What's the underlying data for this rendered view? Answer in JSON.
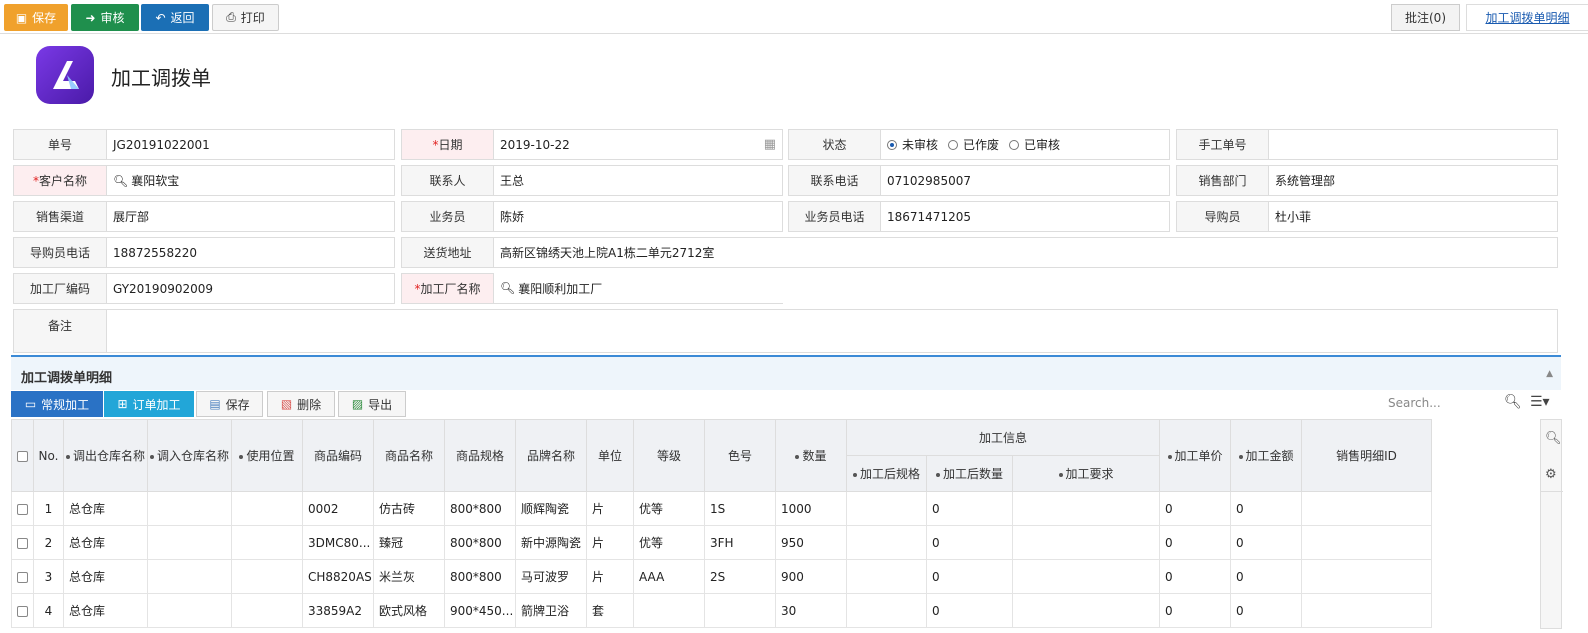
{
  "toolbar": {
    "save": "保存",
    "audit": "审核",
    "back": "返回",
    "print": "打印",
    "note": "批注(0)",
    "detail_link": "加工调拨单明细"
  },
  "page": {
    "title": "加工调拨单"
  },
  "form": {
    "order_no": {
      "label": "单号",
      "value": "JG20191022001"
    },
    "date": {
      "label": "日期",
      "value": "2019-10-22"
    },
    "status": {
      "label": "状态",
      "options": [
        "未审核",
        "已作废",
        "已审核"
      ],
      "selected": "未审核"
    },
    "manual_no": {
      "label": "手工单号",
      "value": ""
    },
    "customer": {
      "label": "客户名称",
      "value": "襄阳软宝"
    },
    "contact": {
      "label": "联系人",
      "value": "王总"
    },
    "phone": {
      "label": "联系电话",
      "value": "07102985007"
    },
    "sales_dept": {
      "label": "销售部门",
      "value": "系统管理部"
    },
    "channel": {
      "label": "销售渠道",
      "value": "展厅部"
    },
    "salesman": {
      "label": "业务员",
      "value": "陈娇"
    },
    "salesman_phone": {
      "label": "业务员电话",
      "value": "18671471205"
    },
    "guide": {
      "label": "导购员",
      "value": "杜小菲"
    },
    "guide_phone": {
      "label": "导购员电话",
      "value": "18872558220"
    },
    "address": {
      "label": "送货地址",
      "value": "高新区锦绣天池上院A1栋二单元2712室"
    },
    "factory_code": {
      "label": "加工厂编码",
      "value": "GY20190902009"
    },
    "factory_name": {
      "label": "加工厂名称",
      "value": "襄阳顺利加工厂"
    },
    "remark": {
      "label": "备注",
      "value": ""
    }
  },
  "detail": {
    "title": "加工调拨单明细",
    "buttons": {
      "regular": "常规加工",
      "order": "订单加工",
      "save": "保存",
      "delete": "删除",
      "export": "导出"
    },
    "search_placeholder": "Search...",
    "columns": {
      "no": "No.",
      "out_wh": "调出仓库名称",
      "in_wh": "调入仓库名称",
      "location": "使用位置",
      "code": "商品编码",
      "name": "商品名称",
      "spec": "商品规格",
      "brand": "品牌名称",
      "unit": "单位",
      "grade": "等级",
      "color": "色号",
      "qty": "数量",
      "proc_group": "加工信息",
      "proc_spec": "加工后规格",
      "proc_qty": "加工后数量",
      "proc_req": "加工要求",
      "price": "加工单价",
      "amount": "加工金额",
      "sale_id": "销售明细ID"
    },
    "rows": [
      {
        "no": "1",
        "out_wh": "总仓库",
        "in_wh": "",
        "location": "",
        "code": "0002",
        "name": "仿古砖",
        "spec": "800*800",
        "brand": "顺辉陶瓷",
        "unit": "片",
        "grade": "优等",
        "color": "1S",
        "qty": "1000",
        "proc_spec": "",
        "proc_qty": "0",
        "proc_req": "",
        "price": "0",
        "amount": "0",
        "sale_id": ""
      },
      {
        "no": "2",
        "out_wh": "总仓库",
        "in_wh": "",
        "location": "",
        "code": "3DMC80...",
        "name": "臻冠",
        "spec": "800*800",
        "brand": "新中源陶瓷",
        "unit": "片",
        "grade": "优等",
        "color": "3FH",
        "qty": "950",
        "proc_spec": "",
        "proc_qty": "0",
        "proc_req": "",
        "price": "0",
        "amount": "0",
        "sale_id": ""
      },
      {
        "no": "3",
        "out_wh": "总仓库",
        "in_wh": "",
        "location": "",
        "code": "CH8820AS",
        "name": "米兰灰",
        "spec": "800*800",
        "brand": "马可波罗",
        "unit": "片",
        "grade": "AAA",
        "color": "2S",
        "qty": "900",
        "proc_spec": "",
        "proc_qty": "0",
        "proc_req": "",
        "price": "0",
        "amount": "0",
        "sale_id": ""
      },
      {
        "no": "4",
        "out_wh": "总仓库",
        "in_wh": "",
        "location": "",
        "code": "33859A2",
        "name": "欧式风格",
        "spec": "900*450...",
        "brand": "箭牌卫浴",
        "unit": "套",
        "grade": "",
        "color": "",
        "qty": "30",
        "proc_spec": "",
        "proc_qty": "0",
        "proc_req": "",
        "price": "0",
        "amount": "0",
        "sale_id": ""
      }
    ]
  }
}
